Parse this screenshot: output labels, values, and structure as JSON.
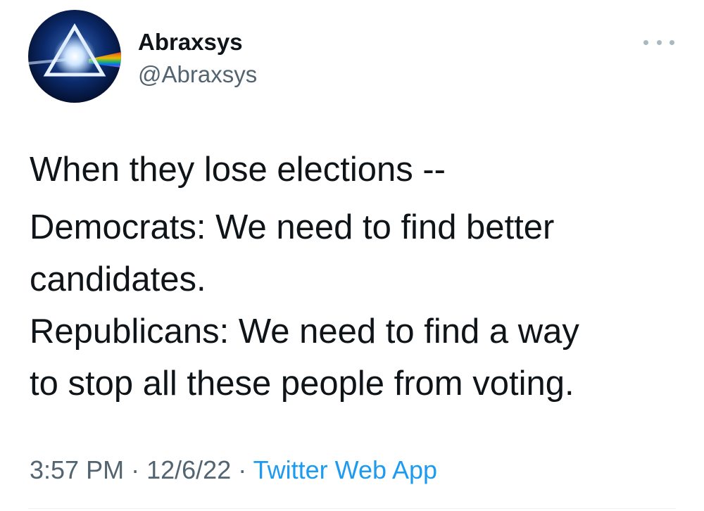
{
  "author": {
    "display_name": "Abraxsys",
    "handle": "@Abraxsys",
    "avatar_icon": "prism-triangle-icon"
  },
  "more_menu": {
    "icon": "more-options-icon"
  },
  "tweet": {
    "lines": [
      "When they lose elections --",
      "Democrats:  We need to find better",
      "candidates.",
      "Republicans:  We need to find a way",
      "to stop all these people from voting."
    ]
  },
  "meta": {
    "time": "3:57 PM",
    "separator": "·",
    "date": "12/6/22",
    "source": "Twitter Web App"
  },
  "colors": {
    "text": "#0f1419",
    "secondary": "#536471",
    "link": "#1d9bf0",
    "menu_dots": "#aab8c2"
  }
}
